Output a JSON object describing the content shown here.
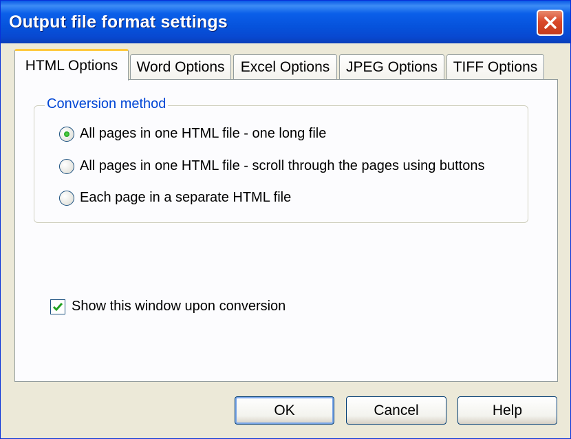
{
  "window": {
    "title": "Output file format settings"
  },
  "tabs": [
    {
      "label": "HTML Options",
      "active": true
    },
    {
      "label": "Word Options"
    },
    {
      "label": "Excel Options"
    },
    {
      "label": "JPEG Options"
    },
    {
      "label": "TIFF Options"
    }
  ],
  "conversion": {
    "group_label": "Conversion method",
    "options": [
      {
        "label": "All pages in one HTML file - one long file",
        "selected": true
      },
      {
        "label": "All pages in one HTML file - scroll through the pages using buttons",
        "selected": false
      },
      {
        "label": "Each page in a separate HTML file",
        "selected": false
      }
    ]
  },
  "show_window": {
    "label": "Show this window upon conversion",
    "checked": true
  },
  "buttons": {
    "ok": "OK",
    "cancel": "Cancel",
    "help": "Help"
  },
  "colors": {
    "title_bar": "#0653dc",
    "close_button": "#d9482a",
    "active_tab_accent": "#ffc83c",
    "group_label": "#0046d5",
    "radio_dot": "#21a121",
    "check_mark": "#21a121"
  }
}
